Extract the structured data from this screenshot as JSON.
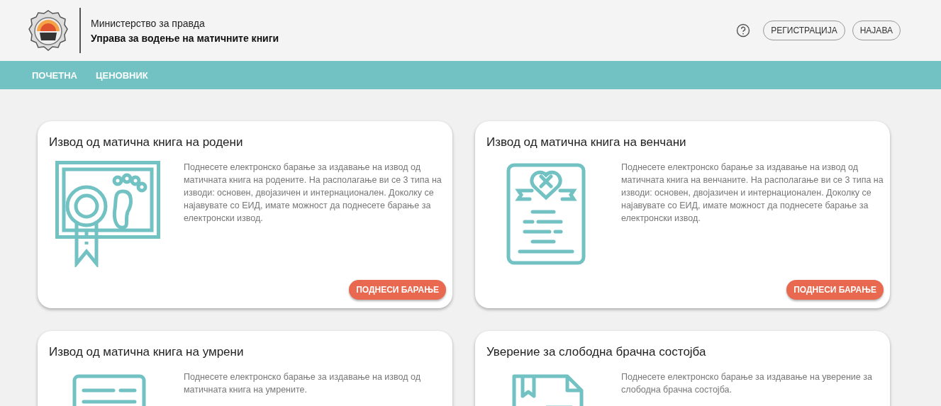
{
  "header": {
    "ministry": "Министерство за правда",
    "department": "Управа за водење на матичните книги",
    "actions": [
      "РЕГИСТРАЦИЈА",
      "НАЈАВА"
    ]
  },
  "nav": [
    {
      "label": "ПОЧЕТНА"
    },
    {
      "label": "ЦЕНОВНИК"
    }
  ],
  "cards": [
    {
      "kind": "birth",
      "title": "Извод од матична книга на родени",
      "text": "Поднесете електронско барање за издавање на извод од матичната книга на родените. На располагање ви се 3 типа на изводи: основен, двојазичен и интернационален. Доколку се најавувате со ЕИД, имате можност да поднесете барање за електронски извод.",
      "button": "ПОДНЕСИ БАРАЊЕ"
    },
    {
      "kind": "marriage",
      "title": "Извод од матична книга на венчани",
      "text": "Поднесете електронско барање за издавање на извод од матичната книга на венчаните. На располагање ви се 3 типа на изводи: основен, двојазичен и интернационален. Доколку се најавувате со ЕИД, имате можност да поднесете барање за електронски извод.",
      "button": "ПОДНЕСИ БАРАЊЕ"
    },
    {
      "kind": "death",
      "title": "Извод од матична книга на умрени",
      "text": "Поднесете електронско барање за издавање на извод од матичната книга на умрените."
    },
    {
      "kind": "single",
      "title": "Уверение за слободна брачна состојба",
      "text": "Поднесете електронско барање за издавање на уверение за слободна брачна состојба."
    }
  ]
}
